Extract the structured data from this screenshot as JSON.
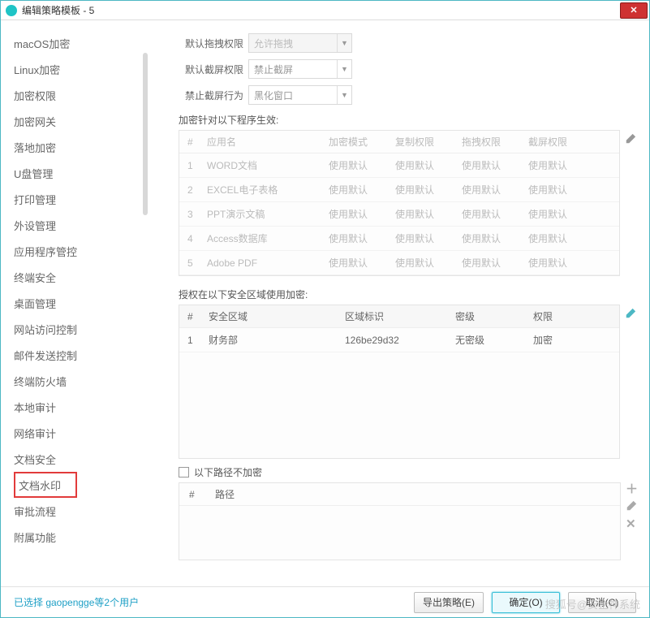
{
  "window": {
    "title": "编辑策略模板 - 5"
  },
  "sidebar": {
    "items": [
      "macOS加密",
      "Linux加密",
      "加密权限",
      "加密网关",
      "落地加密",
      "U盘管理",
      "打印管理",
      "外设管理",
      "应用程序管控",
      "终端安全",
      "桌面管理",
      "网站访问控制",
      "邮件发送控制",
      "终端防火墙",
      "本地审计",
      "网络审计",
      "文档安全",
      "文档水印",
      "审批流程",
      "附属功能"
    ]
  },
  "form": {
    "drag_label": "默认拖拽权限",
    "drag_value": "允许拖拽",
    "capture_label": "默认截屏权限",
    "capture_value": "禁止截屏",
    "behavior_label": "禁止截屏行为",
    "behavior_value": "黑化窗口"
  },
  "apps": {
    "title": "加密针对以下程序生效:",
    "headers": [
      "#",
      "应用名",
      "加密模式",
      "复制权限",
      "拖拽权限",
      "截屏权限"
    ],
    "rows": [
      {
        "n": "1",
        "name": "WORD文档",
        "mode": "使用默认",
        "copy": "使用默认",
        "drag": "使用默认",
        "cap": "使用默认"
      },
      {
        "n": "2",
        "name": "EXCEL电子表格",
        "mode": "使用默认",
        "copy": "使用默认",
        "drag": "使用默认",
        "cap": "使用默认"
      },
      {
        "n": "3",
        "name": "PPT演示文稿",
        "mode": "使用默认",
        "copy": "使用默认",
        "drag": "使用默认",
        "cap": "使用默认"
      },
      {
        "n": "4",
        "name": "Access数据库",
        "mode": "使用默认",
        "copy": "使用默认",
        "drag": "使用默认",
        "cap": "使用默认"
      },
      {
        "n": "5",
        "name": "Adobe PDF",
        "mode": "使用默认",
        "copy": "使用默认",
        "drag": "使用默认",
        "cap": "使用默认"
      }
    ]
  },
  "zones": {
    "title": "授权在以下安全区域使用加密:",
    "headers": [
      "#",
      "安全区域",
      "区域标识",
      "密级",
      "权限"
    ],
    "rows": [
      {
        "n": "1",
        "name": "财务部",
        "id": "126be29d32",
        "level": "无密级",
        "perm": "加密"
      }
    ]
  },
  "paths": {
    "checkbox_label": "以下路径不加密",
    "headers": [
      "#",
      "路径"
    ]
  },
  "footer": {
    "status": "已选择 gaopengge等2个用户",
    "export": "导出策略(E)",
    "ok": "确定(O)",
    "cancel": "取消(C)"
  },
  "watermark": "搜狐号@安企神系统"
}
